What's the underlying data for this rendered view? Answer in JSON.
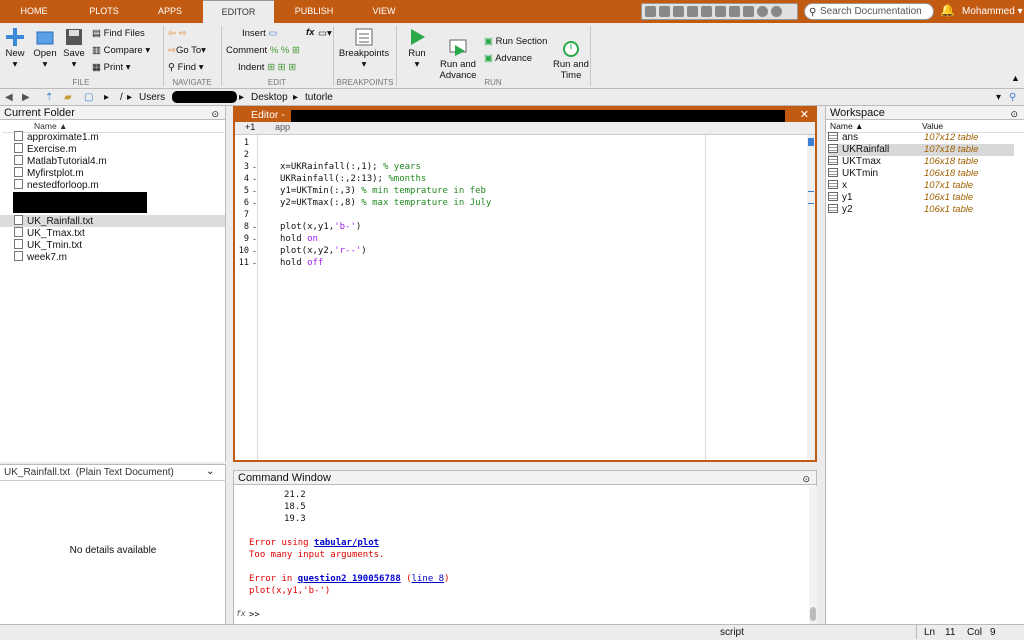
{
  "tabs": [
    "HOME",
    "PLOTS",
    "APPS",
    "EDITOR",
    "PUBLISH",
    "VIEW"
  ],
  "search_placeholder": "Search Documentation",
  "user": "Mohammed",
  "ribbon": {
    "new": "New",
    "open": "Open",
    "save": "Save",
    "find_files": "Find Files",
    "compare": "Compare",
    "print": "Print",
    "go_to": "Go To",
    "find": "Find",
    "insert": "Insert",
    "comment": "Comment",
    "indent": "Indent",
    "breakpoints": "Breakpoints",
    "run": "Run",
    "run_advance": "Run and\nAdvance",
    "run_section": "Run Section",
    "advance": "Advance",
    "run_time": "Run and\nTime",
    "sections": [
      "FILE",
      "NAVIGATE",
      "EDIT",
      "BREAKPOINTS",
      "RUN"
    ],
    "fx": "fx"
  },
  "address": {
    "root": "/",
    "users": "Users",
    "desktop": "Desktop",
    "folder": "tutorle"
  },
  "current_folder": {
    "title": "Current Folder",
    "col": "Name ▲",
    "files": [
      "approximate1.m",
      "Exercise.m",
      "MatlabTutorial4.m",
      "Myfirstplot.m",
      "nestedforloop.m",
      "UK_Rainfall.txt",
      "UK_Tmax.txt",
      "UK_Tmin.txt",
      "week7.m"
    ]
  },
  "details": {
    "title": "UK_Rainfall.txt  (Plain Text Document)",
    "body": "No details available"
  },
  "editor": {
    "title": "Editor -",
    "tab1": "+1",
    "tab2": "app",
    "lines": [
      "1",
      "2",
      "3",
      "4",
      "5",
      "6",
      "7",
      "8",
      "9",
      "10",
      "11"
    ],
    "code": [
      {
        "a": "x=UKRainfall(:,1); ",
        "c": "% years"
      },
      {
        "a": "UKRainfall(:,2:13); ",
        "c": "%months"
      },
      {
        "a": "y1=UKTmin(:,3) ",
        "c": "% min temprature in feb"
      },
      {
        "a": "y2=UKTmax(:,8) ",
        "c": "% max temprature in July"
      },
      {
        "a": "plot(x,y1,",
        "s": "'b-'",
        "b": ")"
      },
      {
        "a": "hold ",
        "k": "on"
      },
      {
        "a": "plot(x,y2,",
        "s": "'r--'",
        "b": ")"
      },
      {
        "a": "hold ",
        "k": "off"
      }
    ]
  },
  "command": {
    "title": "Command Window",
    "vals": [
      "21.2",
      "18.5",
      "19.3"
    ],
    "err1a": "Error using ",
    "err1l": "tabular/plot",
    "err1b": "Too many input arguments.",
    "err2a": "Error in ",
    "err2l": "question2_190056788",
    "err2m": " (",
    "err2l2": "line 8",
    "err2e": ")",
    "err2code": "plot(x,y1,'b-')",
    "prompt": ">>",
    "fx": "fx"
  },
  "workspace": {
    "title": "Workspace",
    "col_name": "Name ▲",
    "col_value": "Value",
    "vars": [
      {
        "n": "ans",
        "v": "107x12 table"
      },
      {
        "n": "UKRainfall",
        "v": "107x18 table"
      },
      {
        "n": "UKTmax",
        "v": "106x18 table"
      },
      {
        "n": "UKTmin",
        "v": "106x18 table"
      },
      {
        "n": "x",
        "v": "107x1 table"
      },
      {
        "n": "y1",
        "v": "106x1 table"
      },
      {
        "n": "y2",
        "v": "106x1 table"
      }
    ]
  },
  "status": {
    "mode": "script",
    "ln_label": "Ln",
    "ln": "11",
    "col_label": "Col",
    "col": "9"
  },
  "colors": {
    "accent": "#c35a12",
    "comment": "#228b22",
    "string": "#a020f0",
    "keyword": "#a020f0",
    "link": "#0000cc",
    "error": "#e00000"
  }
}
